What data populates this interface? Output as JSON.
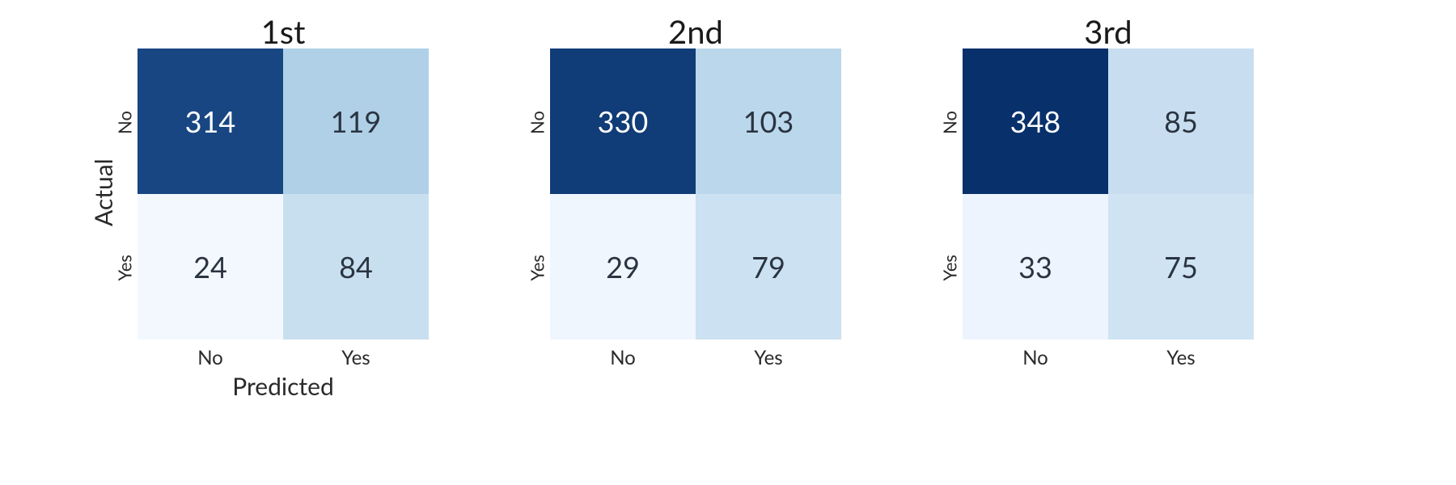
{
  "chart_data": [
    {
      "type": "heatmap",
      "title": "1st",
      "xlabel": "Predicted",
      "ylabel": "Actual",
      "x_categories": [
        "No",
        "Yes"
      ],
      "y_categories": [
        "No",
        "Yes"
      ],
      "values": [
        [
          314,
          119
        ],
        [
          24,
          84
        ]
      ],
      "show_xlabel": true,
      "show_ylabel": true
    },
    {
      "type": "heatmap",
      "title": "2nd",
      "xlabel": "Predicted",
      "ylabel": "Actual",
      "x_categories": [
        "No",
        "Yes"
      ],
      "y_categories": [
        "No",
        "Yes"
      ],
      "values": [
        [
          330,
          103
        ],
        [
          29,
          79
        ]
      ],
      "show_xlabel": false,
      "show_ylabel": false
    },
    {
      "type": "heatmap",
      "title": "3rd",
      "xlabel": "Predicted",
      "ylabel": "Actual",
      "x_categories": [
        "No",
        "Yes"
      ],
      "y_categories": [
        "No",
        "Yes"
      ],
      "values": [
        [
          348,
          85
        ],
        [
          33,
          75
        ]
      ],
      "show_xlabel": false,
      "show_ylabel": false
    }
  ],
  "colorscale": {
    "min": 24,
    "max": 348,
    "low_color": "#f3f8ff",
    "high_color": "#08306b"
  }
}
